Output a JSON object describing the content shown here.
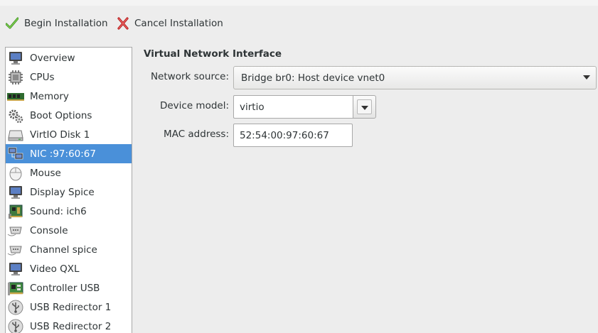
{
  "toolbar": {
    "begin_label": "Begin Installation",
    "cancel_label": "Cancel Installation"
  },
  "sidebar": {
    "items": [
      {
        "label": "Overview",
        "icon": "monitor-icon"
      },
      {
        "label": "CPUs",
        "icon": "cpu-icon"
      },
      {
        "label": "Memory",
        "icon": "memory-icon"
      },
      {
        "label": "Boot Options",
        "icon": "gears-icon"
      },
      {
        "label": "VirtIO Disk 1",
        "icon": "disk-icon"
      },
      {
        "label": "NIC :97:60:67",
        "icon": "network-icon",
        "selected": true
      },
      {
        "label": "Mouse",
        "icon": "mouse-icon"
      },
      {
        "label": "Display Spice",
        "icon": "display-icon"
      },
      {
        "label": "Sound: ich6",
        "icon": "sound-card-icon"
      },
      {
        "label": "Console",
        "icon": "serial-icon"
      },
      {
        "label": "Channel spice",
        "icon": "serial-icon"
      },
      {
        "label": "Video QXL",
        "icon": "display-icon"
      },
      {
        "label": "Controller USB",
        "icon": "controller-icon"
      },
      {
        "label": "USB Redirector 1",
        "icon": "usb-icon"
      },
      {
        "label": "USB Redirector 2",
        "icon": "usb-icon"
      }
    ]
  },
  "main": {
    "section_title": "Virtual Network Interface",
    "network_source_label": "Network source:",
    "network_source_value": "Bridge br0: Host device vnet0",
    "device_model_label": "Device model:",
    "device_model_value": "virtio",
    "mac_address_label": "MAC address:",
    "mac_address_value": "52:54:00:97:60:67"
  },
  "colors": {
    "selection": "#4a90d9",
    "background": "#ededed"
  }
}
